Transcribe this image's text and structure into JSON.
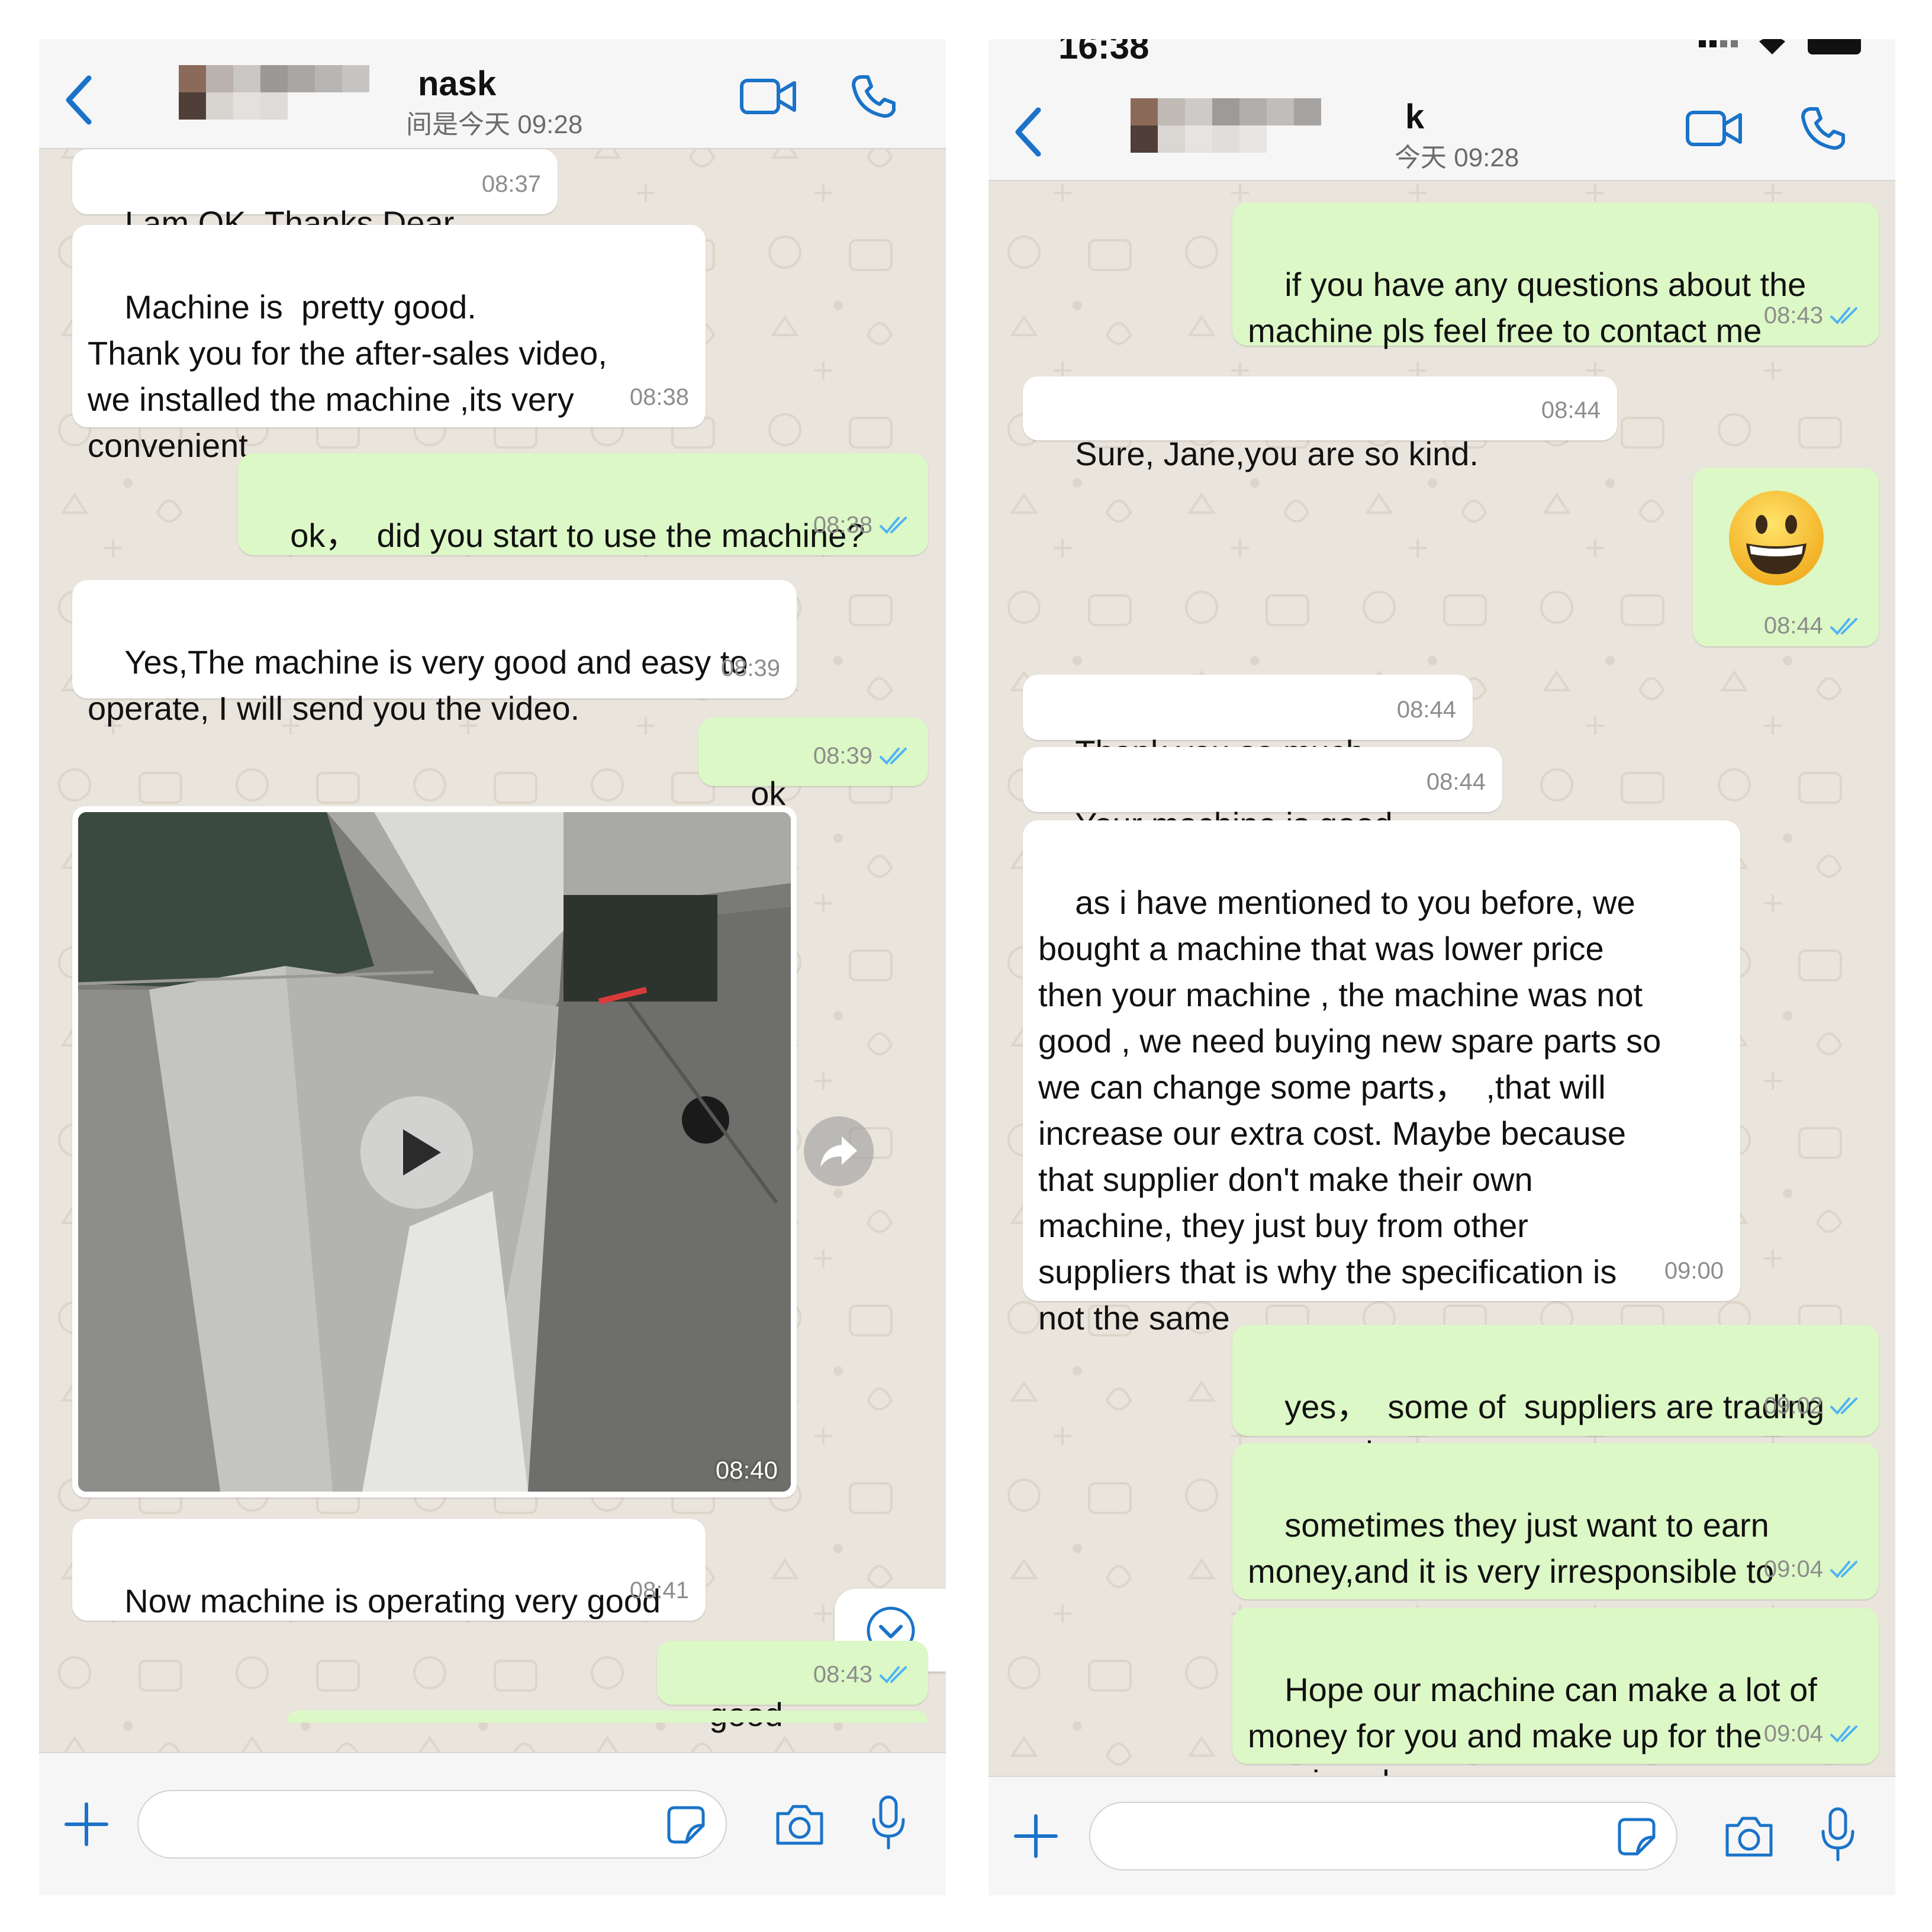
{
  "colors": {
    "chat_bg": "#e9e4dc",
    "incoming_bubble": "#ffffff",
    "outgoing_bubble": "#dcf8c6",
    "accent_blue": "#1a73c8",
    "read_tick_blue": "#4fb3f6",
    "timestamp_gray": "#8d8d8d"
  },
  "left": {
    "header": {
      "contact_name_partial": "nask",
      "subtitle": "间是今天 09:28"
    },
    "messages": [
      {
        "dir": "in",
        "text": "I am OK ,Thanks Dear",
        "time": "08:37"
      },
      {
        "dir": "in",
        "text": "Machine is  pretty good.\nThank you for the after-sales video,\nwe installed the machine ,its very\nconvenient",
        "time": "08:38"
      },
      {
        "dir": "out",
        "text": "ok，  did you start to use the machine?",
        "time": "08:38"
      },
      {
        "dir": "in",
        "text": "Yes,The machine is very good and easy to\noperate, I will send you the video.",
        "time": "08:39"
      },
      {
        "dir": "out",
        "text": "ok",
        "time": "08:39"
      },
      {
        "dir": "in",
        "text": "Now machine is operating very good",
        "time": "08:41"
      },
      {
        "dir": "out",
        "text": "good",
        "time": "08:43"
      }
    ],
    "video": {
      "time": "08:40"
    }
  },
  "right": {
    "status_bar": {
      "time": "16:38"
    },
    "header": {
      "contact_name_partial": "k",
      "subtitle": "今天 09:28"
    },
    "messages": [
      {
        "dir": "out",
        "text": "if you have any questions about the\nmachine pls feel free to contact me",
        "time": "08:43"
      },
      {
        "dir": "in",
        "text": "Sure, Jane,you are so kind.",
        "time": "08:44"
      },
      {
        "dir": "in",
        "text": "Thank you so much",
        "time": "08:44"
      },
      {
        "dir": "in",
        "text": "Your machine is good",
        "time": "08:44"
      },
      {
        "dir": "in",
        "text": "as i have mentioned to you before, we\nbought a machine that was lower price\nthen your machine , the machine was not\ngood , we need buying new spare parts so\nwe can change some parts，  ,that will\nincrease our extra cost. Maybe because\nthat supplier don't make their own\nmachine, they just buy from other\nsuppliers that is why the specification is\nnot the same",
        "time": "09:00"
      },
      {
        "dir": "out",
        "text": "yes，  some of  suppliers are trading\ncompanies",
        "time": "09:02"
      },
      {
        "dir": "out",
        "text": "sometimes they just want to earn\nmoney,and it is very irresponsible to\nconsumers",
        "time": "09:04"
      },
      {
        "dir": "out",
        "text": "Hope our machine can make a lot of\nmoney for you and make up for the\nprevious losses",
        "time": "09:04"
      }
    ],
    "emoji_message": {
      "emoji": "😀",
      "time": "08:44"
    }
  },
  "icons": {
    "back": "chevron-left-icon",
    "video_call": "video-camera-icon",
    "voice_call": "phone-icon",
    "attach": "plus-icon",
    "sticker": "sticker-icon",
    "camera": "camera-icon",
    "mic": "microphone-icon",
    "play": "play-icon",
    "forward": "forward-icon",
    "scroll_down": "chevron-down-circle-icon",
    "read_receipt": "double-check-icon"
  }
}
